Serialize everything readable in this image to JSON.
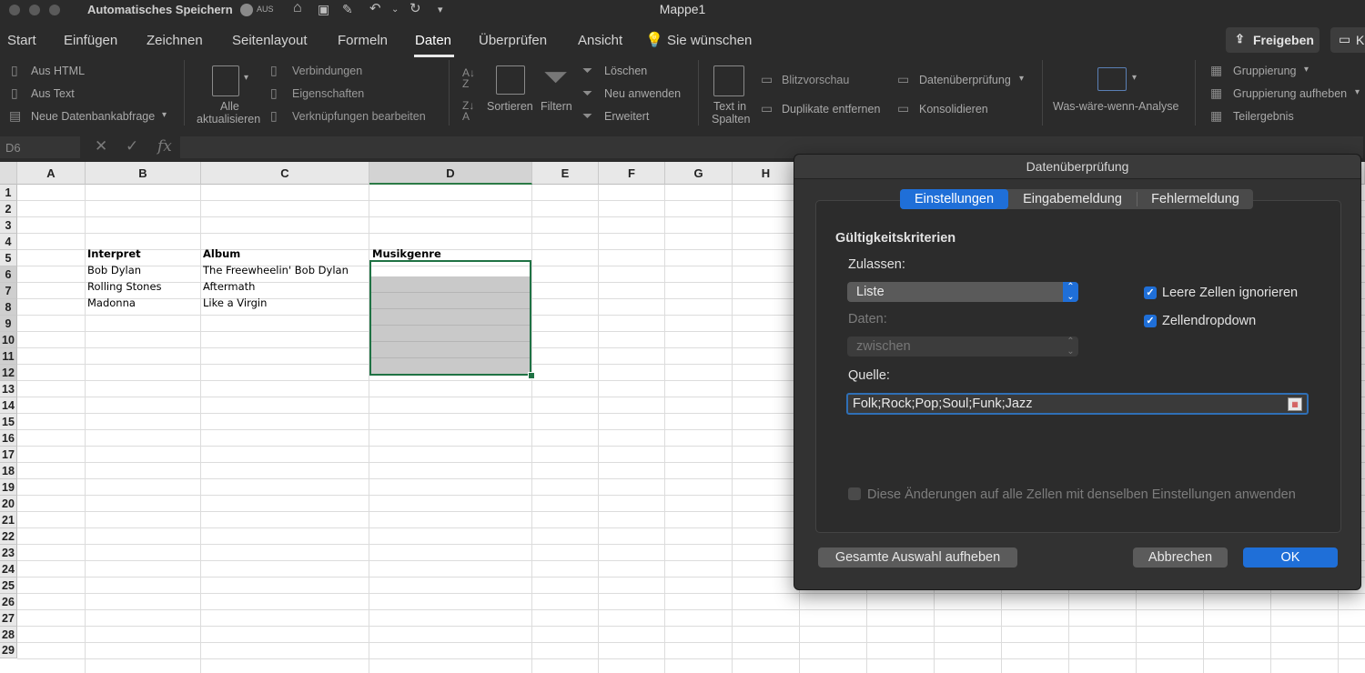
{
  "titlebar": {
    "autosave_label": "Automatisches Speichern",
    "autosave_state": "AUS",
    "document_title": "Mappe1",
    "quick_icons": [
      "home-icon",
      "save-icon",
      "edit-icon",
      "undo-icon",
      "redo-icon",
      "more-icon"
    ]
  },
  "tabs": [
    "Start",
    "Einfügen",
    "Zeichnen",
    "Seitenlayout",
    "Formeln",
    "Daten",
    "Überprüfen",
    "Ansicht"
  ],
  "active_tab": "Daten",
  "tell_me": "Sie wünschen",
  "share_label": "Freigeben",
  "comments_label": "K",
  "ribbon": {
    "aus_html": "Aus HTML",
    "aus_text": "Aus Text",
    "neue_db": "Neue Datenbankabfrage",
    "alle_1": "Alle",
    "alle_2": "aktualisieren",
    "verbindungen": "Verbindungen",
    "eigenschaften": "Eigenschaften",
    "verknuepfungen": "Verknüpfungen bearbeiten",
    "sortieren": "Sortieren",
    "filtern": "Filtern",
    "loeschen": "Löschen",
    "neu_anwenden": "Neu anwenden",
    "erweitert": "Erweitert",
    "text_in_1": "Text in",
    "text_in_2": "Spalten",
    "blitzvorschau": "Blitzvorschau",
    "duplikate": "Duplikate entfernen",
    "datenueberpruefung": "Datenüberprüfung",
    "konsolidieren": "Konsolidieren",
    "was_waere": "Was-wäre-wenn-Analyse",
    "gruppierung": "Gruppierung",
    "gruppierung_auf": "Gruppierung aufheben",
    "teilergebnis": "Teilergebnis"
  },
  "formula_bar": {
    "name_box": "D6",
    "content": ""
  },
  "grid": {
    "columns": [
      "A",
      "B",
      "C",
      "D",
      "E",
      "F",
      "G",
      "H"
    ],
    "selected_column": "D",
    "rows": [
      "1",
      "2",
      "3",
      "4",
      "5",
      "6",
      "7",
      "8",
      "9",
      "10",
      "11",
      "12",
      "13",
      "14",
      "15",
      "16",
      "17",
      "18",
      "19",
      "20",
      "21",
      "22",
      "23",
      "24",
      "25",
      "26",
      "27",
      "28",
      "29"
    ],
    "cells": {
      "b5": "Interpret",
      "c5": "Album",
      "d5": "Musikgenre",
      "b6": "Bob Dylan",
      "c6": "The Freewheelin' Bob Dylan",
      "b7": "Rolling Stones",
      "c7": "Aftermath",
      "b8": "Madonna",
      "c8": "Like a Virgin"
    }
  },
  "dialog": {
    "title": "Datenüberprüfung",
    "tabs": [
      "Einstellungen",
      "Eingabemeldung",
      "Fehlermeldung"
    ],
    "active_tab": "Einstellungen",
    "section_title": "Gültigkeitskriterien",
    "allow_label": "Zulassen:",
    "allow_value": "Liste",
    "data_label": "Daten:",
    "data_value": "zwischen",
    "ignore_blank_label": "Leere Zellen ignorieren",
    "ignore_blank_checked": true,
    "in_cell_dropdown_label": "Zellendropdown",
    "in_cell_dropdown_checked": true,
    "source_label": "Quelle:",
    "source_value": "Folk;Rock;Pop;Soul;Funk;Jazz",
    "apply_all_label": "Diese Änderungen auf alle Zellen mit denselben Einstellungen anwenden",
    "apply_all_checked": false,
    "clear_all_label": "Gesamte Auswahl aufheben",
    "cancel_label": "Abbrechen",
    "ok_label": "OK"
  },
  "colors": {
    "accent": "#1f6fd8",
    "selection": "#1f7244",
    "chrome": "#2b2b2b"
  }
}
